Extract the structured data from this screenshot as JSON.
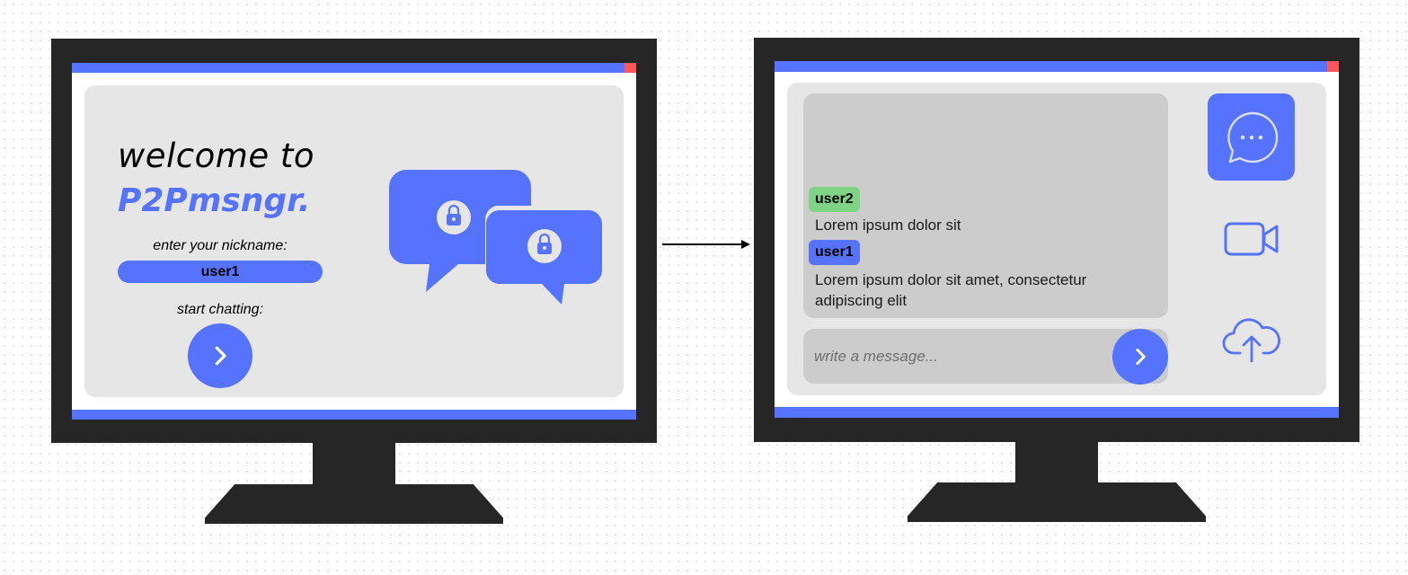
{
  "login": {
    "welcome": "welcome to",
    "brand": "P2Pmsngr.",
    "nickname_label": "enter your nickname:",
    "nickname_value": "user1",
    "start_label": "start chatting:",
    "start_icon": "chevron-right-icon",
    "illustration_icons": [
      "chat-bubble-icon",
      "lock-icon"
    ]
  },
  "chat": {
    "messages": [
      {
        "user": "user2",
        "text": "Lorem ipsum dolor sit",
        "tag_color": "#7ed384"
      },
      {
        "user": "user1",
        "text": "Lorem ipsum dolor sit amet, consectetur adipiscing elit",
        "tag_color": "#5673ff"
      }
    ],
    "input_placeholder": "write a message...",
    "send_icon": "chevron-right-icon",
    "sidebar": [
      "chat-icon",
      "video-camera-icon",
      "cloud-upload-icon"
    ]
  },
  "colors": {
    "accent": "#5673ff",
    "close": "#ff5757",
    "frame": "#262626",
    "panel": "#e6e6e6",
    "chat_bg": "#cccccc"
  }
}
